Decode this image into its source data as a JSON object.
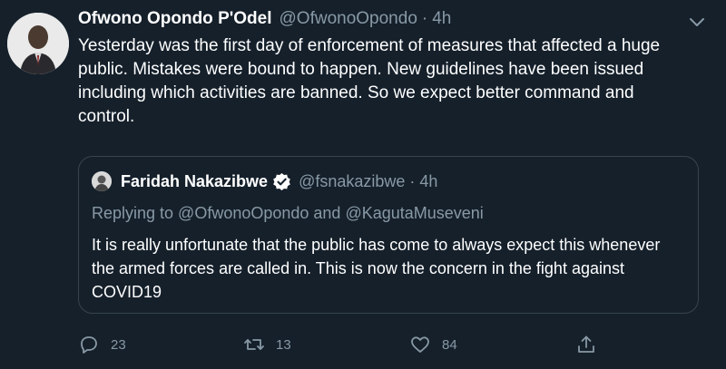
{
  "tweet": {
    "author_name": "Ofwono Opondo P'Odel",
    "author_handle": "@OfwonoOpondo",
    "separator": "·",
    "time": "4h",
    "text": "Yesterday was the first day of enforcement of measures that affected a huge public. Mistakes were bound to happen. New guidelines have been issued including which activities are banned. So we expect better command and control."
  },
  "quote": {
    "author_name": "Faridah Nakazibwe",
    "author_handle": "@fsnakazibwe",
    "separator": "·",
    "time": "4h",
    "replying_to": "Replying to @OfwonoOpondo and @KagutaMuseveni",
    "text": "It is really unfortunate that the public has come to always expect this whenever the armed forces are called in. This is now the concern in the fight against COVID19"
  },
  "actions": {
    "replies": "23",
    "retweets": "13",
    "likes": "84"
  },
  "colors": {
    "background": "#15202b",
    "secondary_text": "#8899a6",
    "border": "#38444d",
    "verified": "#ffffff"
  },
  "icons": [
    "more-chevron-icon",
    "verified-badge-icon",
    "reply-icon",
    "retweet-icon",
    "like-icon",
    "share-icon"
  ]
}
